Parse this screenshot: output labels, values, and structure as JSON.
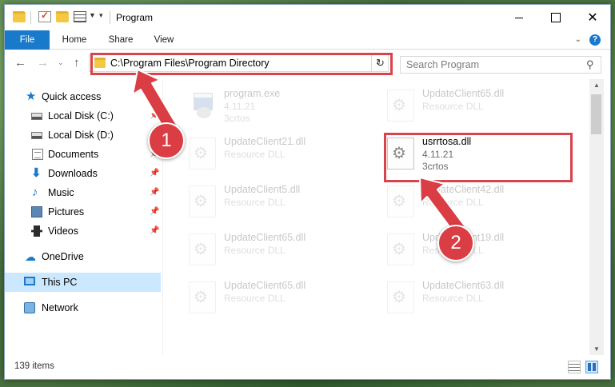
{
  "window": {
    "title": "Program",
    "minimize": "",
    "maximize": "",
    "close": "✕"
  },
  "ribbon": {
    "tabs": [
      {
        "label": "File",
        "active": true
      },
      {
        "label": "Home"
      },
      {
        "label": "Share"
      },
      {
        "label": "View"
      }
    ],
    "help": "?"
  },
  "nav": {
    "address": "C:\\Program Files\\Program Directory",
    "search_placeholder": "Search Program"
  },
  "sidebar": {
    "items": [
      {
        "label": "Quick access",
        "icon": "star-icon"
      },
      {
        "label": "Local Disk (C:)",
        "icon": "disk-icon",
        "pinned": true
      },
      {
        "label": "Local Disk (D:)",
        "icon": "disk-icon",
        "pinned": true
      },
      {
        "label": "Documents",
        "icon": "documents-icon",
        "pinned": true
      },
      {
        "label": "Downloads",
        "icon": "downloads-icon",
        "pinned": true
      },
      {
        "label": "Music",
        "icon": "music-icon",
        "pinned": true
      },
      {
        "label": "Pictures",
        "icon": "pictures-icon",
        "pinned": true
      },
      {
        "label": "Videos",
        "icon": "videos-icon",
        "pinned": true
      },
      {
        "label": "OneDrive",
        "icon": "cloud-icon"
      },
      {
        "label": "This PC",
        "icon": "computer-icon",
        "selected": true
      },
      {
        "label": "Network",
        "icon": "network-icon"
      }
    ]
  },
  "files": [
    {
      "name": "program.exe",
      "line2": "4.11.21",
      "line3": "3crtos",
      "type": "exe",
      "faded": true
    },
    {
      "name": "UpdateClient65.dll",
      "line2": "Resource DLL",
      "type": "dll",
      "faded": true
    },
    {
      "name": "UpdateClient21.dll",
      "line2": "Resource DLL",
      "type": "dll",
      "faded": true
    },
    {
      "name": "usrrtosa.dll",
      "line2": "4.11.21",
      "line3": "3crtos",
      "type": "dll",
      "faded": false
    },
    {
      "name": "UpdateClient5.dll",
      "line2": "Resource DLL",
      "type": "dll",
      "faded": true
    },
    {
      "name": "UpdateClient42.dll",
      "line2": "Resource DLL",
      "type": "dll",
      "faded": true
    },
    {
      "name": "UpdateClient65.dll",
      "line2": "Resource DLL",
      "type": "dll",
      "faded": true
    },
    {
      "name": "UpdateClient19.dll",
      "line2": "Resource DLL",
      "type": "dll",
      "faded": true
    },
    {
      "name": "UpdateClient65.dll",
      "line2": "Resource DLL",
      "type": "dll",
      "faded": true
    },
    {
      "name": "UpdateClient63.dll",
      "line2": "Resource DLL",
      "type": "dll",
      "faded": true
    }
  ],
  "status": {
    "item_count": "139 items"
  },
  "annotations": {
    "step1": "1",
    "step2": "2",
    "color": "#db3d44"
  }
}
